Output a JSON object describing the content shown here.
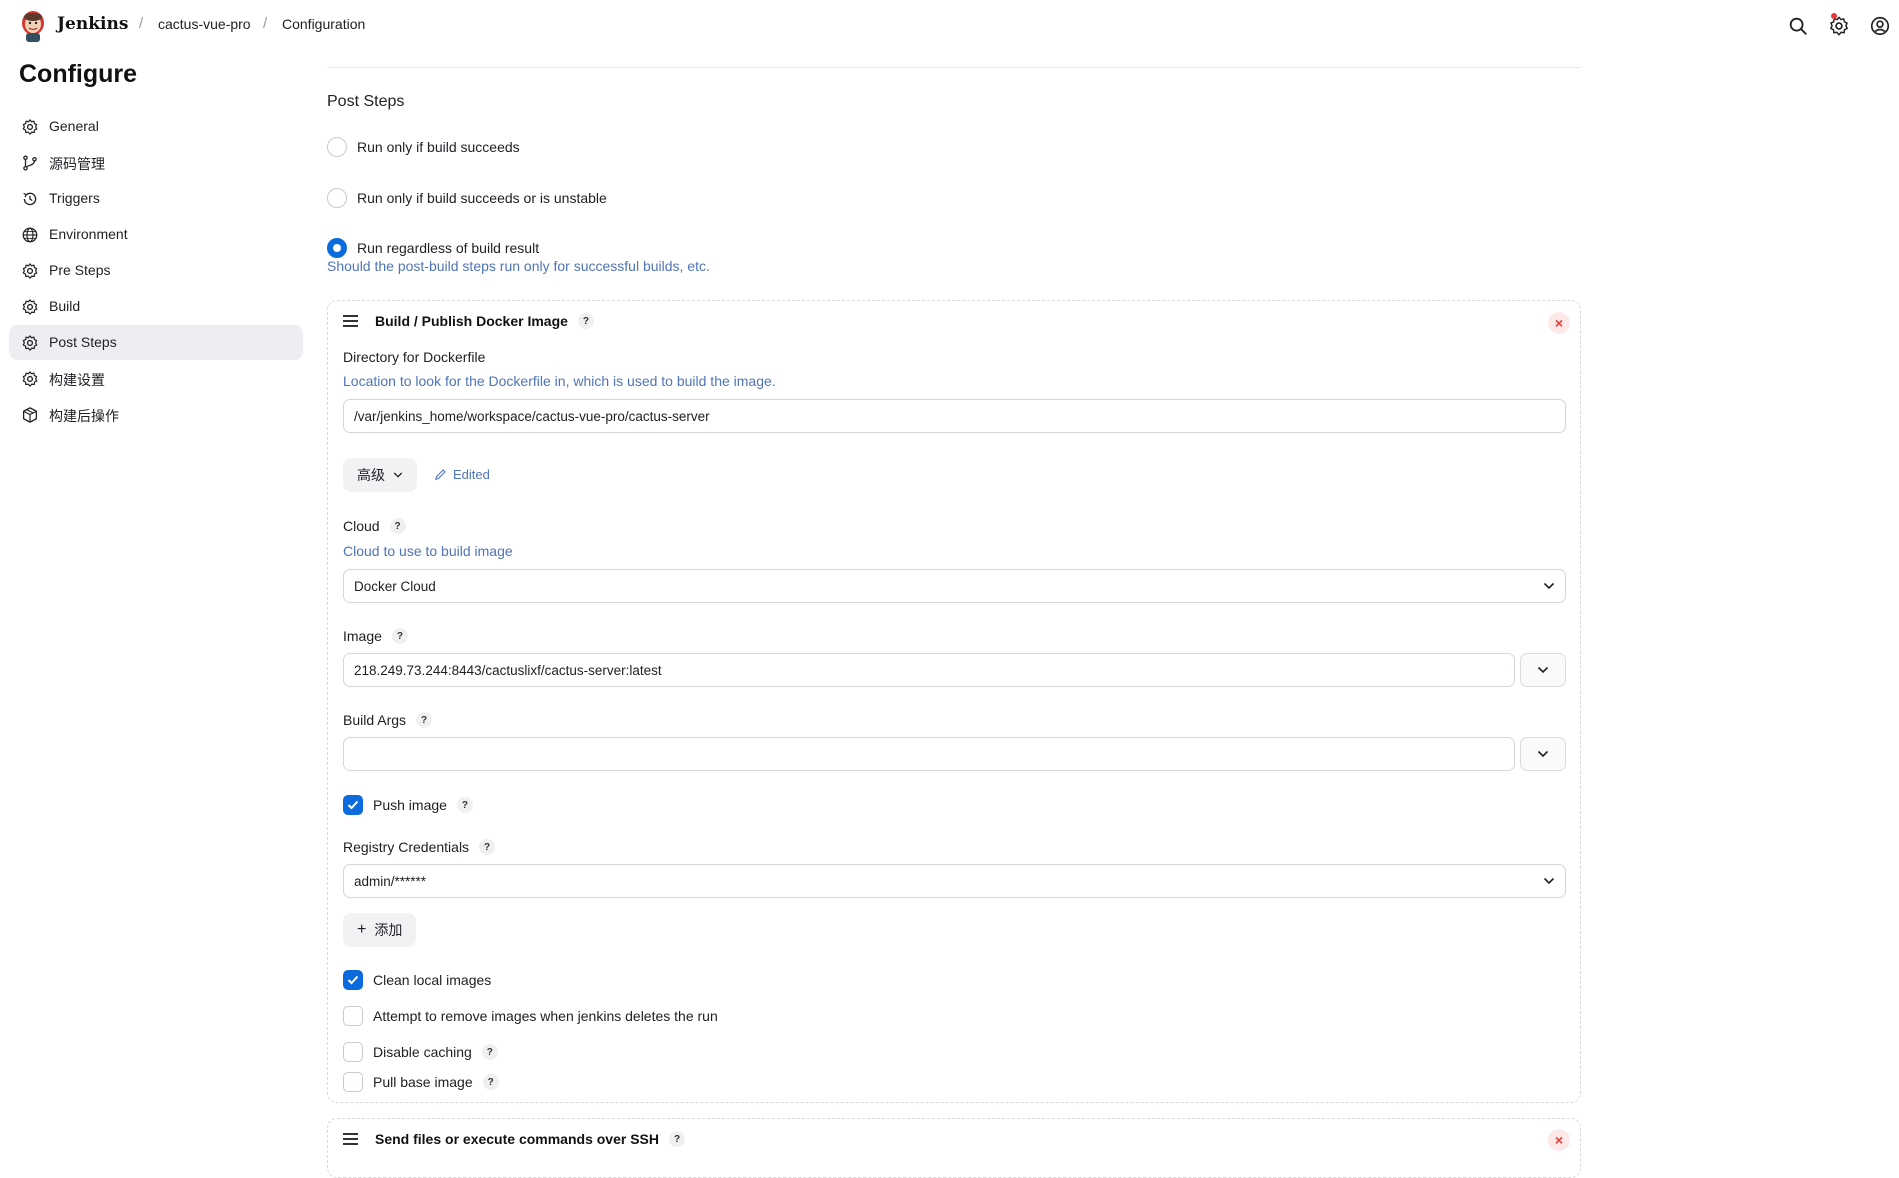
{
  "header": {
    "brand": "Jenkins",
    "breadcrumbs": [
      "cactus-vue-pro",
      "Configuration"
    ],
    "separators": [
      "/",
      "/"
    ]
  },
  "sidebar": {
    "title": "Configure",
    "items": [
      {
        "label": "General",
        "icon": "gear-icon"
      },
      {
        "label": "源码管理",
        "icon": "branch-icon"
      },
      {
        "label": "Triggers",
        "icon": "clock-icon"
      },
      {
        "label": "Environment",
        "icon": "globe-icon"
      },
      {
        "label": "Pre Steps",
        "icon": "gear-icon"
      },
      {
        "label": "Build",
        "icon": "gear-icon"
      },
      {
        "label": "Post Steps",
        "icon": "gear-icon",
        "active": true
      },
      {
        "label": "构建设置",
        "icon": "gear-icon"
      },
      {
        "label": "构建后操作",
        "icon": "package-icon"
      }
    ]
  },
  "post_steps": {
    "title": "Post Steps",
    "options": [
      {
        "label": "Run only if build succeeds",
        "checked": false
      },
      {
        "label": "Run only if build succeeds or is unstable",
        "checked": false
      },
      {
        "label": "Run regardless of build result",
        "checked": true
      }
    ],
    "help": "Should the post-build steps run only for successful builds, etc."
  },
  "docker_step": {
    "title": "Build / Publish Docker Image",
    "help_mark": "?",
    "close_glyph": "×",
    "dockerfile_label": "Directory for Dockerfile",
    "dockerfile_help": "Location to look for the Dockerfile in, which is used to build the image.",
    "dockerfile_value": "/var/jenkins_home/workspace/cactus-vue-pro/cactus-server",
    "advanced_label": "高级",
    "edited_label": "Edited",
    "cloud_label": "Cloud",
    "cloud_help": "Cloud to use to build image",
    "cloud_value": "Docker Cloud",
    "image_label": "Image",
    "image_value": "218.249.73.244:8443/cactuslixf/cactus-server:latest",
    "build_args_label": "Build Args",
    "build_args_value": "",
    "push_image_label": "Push image",
    "push_image_checked": true,
    "registry_label": "Registry Credentials",
    "registry_value": "admin/******",
    "add_label": "添加",
    "add_glyph": "+",
    "clean_label": "Clean local images",
    "clean_checked": true,
    "remove_label": "Attempt to remove images when jenkins deletes the run",
    "remove_checked": false,
    "disable_caching_label": "Disable caching",
    "disable_caching_checked": false,
    "pull_base_label": "Pull base image",
    "pull_base_checked": false
  },
  "ssh_step": {
    "title": "Send files or execute commands over SSH",
    "help_mark": "?",
    "close_glyph": "×"
  },
  "colors": {
    "accent": "#0b6bdc",
    "help_text": "#4f74b8",
    "close": "#e53935",
    "active_bg": "#ededf2"
  }
}
